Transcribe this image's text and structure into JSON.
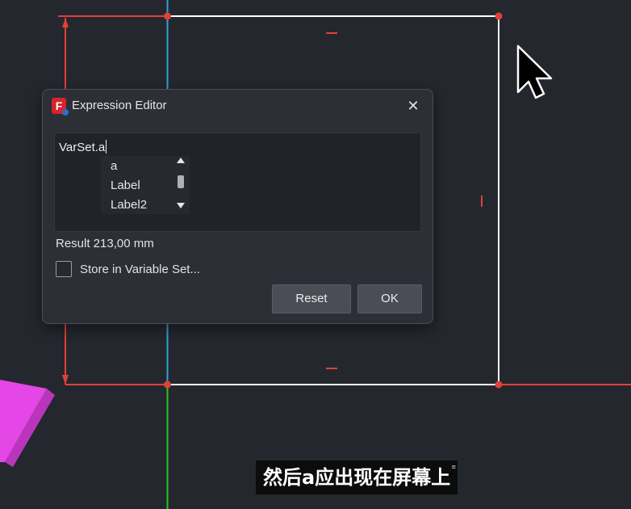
{
  "dialog": {
    "title": "Expression Editor",
    "close_symbol": "✕",
    "logo_letter": "F",
    "expression": "VarSet.a",
    "completions": [
      "a",
      "Label",
      "Label2"
    ],
    "result": "Result 213,00 mm",
    "store_label": "Store in Variable Set...",
    "store_checked": false,
    "reset_label": "Reset",
    "ok_label": "OK"
  },
  "subtitle": {
    "text": "然后a应出现在屏幕上"
  },
  "icons": {
    "app": "freecad-logo-icon",
    "close": "close-icon",
    "cursor": "mouse-pointer-icon"
  },
  "colors": {
    "background": "#24272e",
    "sketch_red": "#e0403a",
    "sketch_white": "#ffffff",
    "axis_blue": "#2aa7d4",
    "axis_green": "#25c425",
    "solid_magenta": "#e546e6"
  }
}
